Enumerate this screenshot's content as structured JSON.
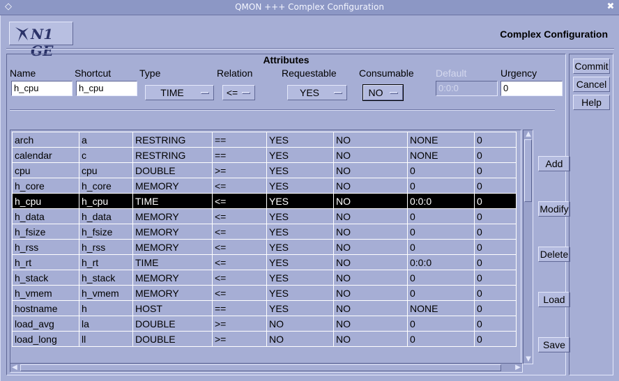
{
  "window": {
    "title": "QMON +++ Complex Configuration",
    "menu_glyph": "◇",
    "close_glyph": "✖"
  },
  "header": {
    "logo_text": "N1 GE",
    "title": "Complex Configuration"
  },
  "attributes": {
    "title": "Attributes",
    "labels": {
      "name": "Name",
      "shortcut": "Shortcut",
      "type": "Type",
      "relation": "Relation",
      "requestable": "Requestable",
      "consumable": "Consumable",
      "default": "Default",
      "urgency": "Urgency"
    },
    "values": {
      "name": "h_cpu",
      "shortcut": "h_cpu",
      "type": "TIME",
      "relation": "<=",
      "requestable": "YES",
      "consumable": "NO",
      "default": "0:0:0",
      "urgency": "0"
    }
  },
  "table": {
    "rows": [
      [
        "arch",
        "a",
        "RESTRING",
        "==",
        "YES",
        "NO",
        "NONE",
        "0"
      ],
      [
        "calendar",
        "c",
        "RESTRING",
        "==",
        "YES",
        "NO",
        "NONE",
        "0"
      ],
      [
        "cpu",
        "cpu",
        "DOUBLE",
        ">=",
        "YES",
        "NO",
        "0",
        "0"
      ],
      [
        "h_core",
        "h_core",
        "MEMORY",
        "<=",
        "YES",
        "NO",
        "0",
        "0"
      ],
      [
        "h_cpu",
        "h_cpu",
        "TIME",
        "<=",
        "YES",
        "NO",
        "0:0:0",
        "0"
      ],
      [
        "h_data",
        "h_data",
        "MEMORY",
        "<=",
        "YES",
        "NO",
        "0",
        "0"
      ],
      [
        "h_fsize",
        "h_fsize",
        "MEMORY",
        "<=",
        "YES",
        "NO",
        "0",
        "0"
      ],
      [
        "h_rss",
        "h_rss",
        "MEMORY",
        "<=",
        "YES",
        "NO",
        "0",
        "0"
      ],
      [
        "h_rt",
        "h_rt",
        "TIME",
        "<=",
        "YES",
        "NO",
        "0:0:0",
        "0"
      ],
      [
        "h_stack",
        "h_stack",
        "MEMORY",
        "<=",
        "YES",
        "NO",
        "0",
        "0"
      ],
      [
        "h_vmem",
        "h_vmem",
        "MEMORY",
        "<=",
        "YES",
        "NO",
        "0",
        "0"
      ],
      [
        "hostname",
        "h",
        "HOST",
        "==",
        "YES",
        "NO",
        "NONE",
        "0"
      ],
      [
        "load_avg",
        "la",
        "DOUBLE",
        ">=",
        "NO",
        "NO",
        "0",
        "0"
      ],
      [
        "load_long",
        "ll",
        "DOUBLE",
        ">=",
        "NO",
        "NO",
        "0",
        "0"
      ]
    ],
    "selected_index": 4
  },
  "actions": {
    "add": "Add",
    "modify": "Modify",
    "delete": "Delete",
    "load": "Load",
    "save": "Save"
  },
  "side": {
    "commit": "Commit",
    "cancel": "Cancel",
    "help": "Help"
  }
}
